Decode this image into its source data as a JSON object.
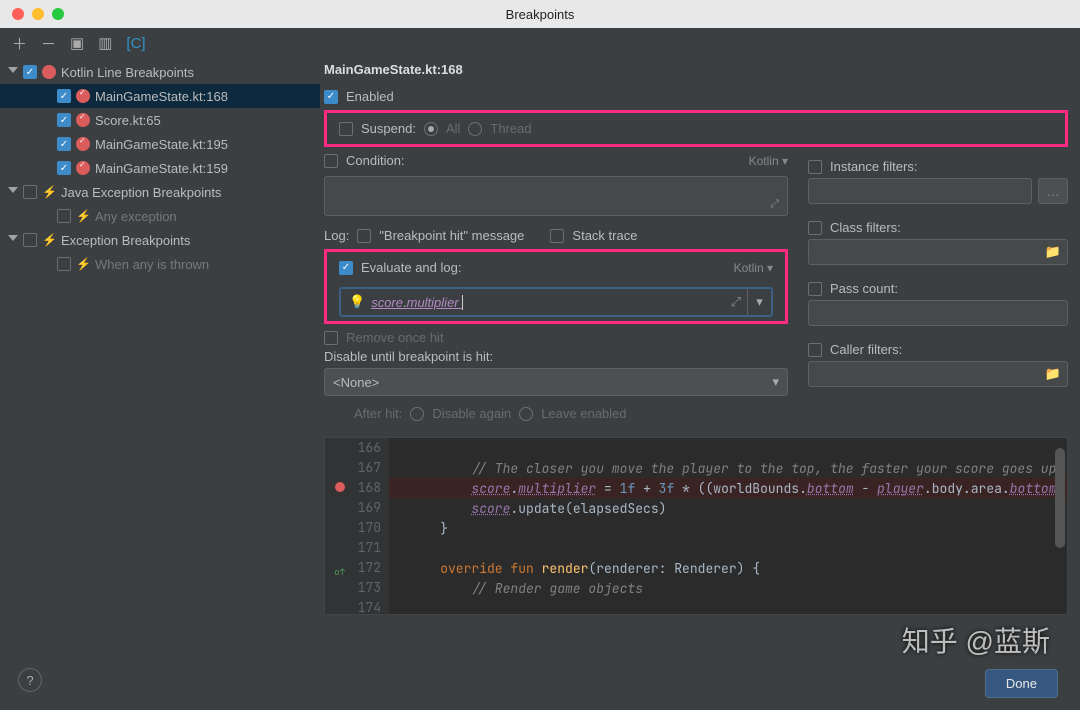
{
  "window": {
    "title": "Breakpoints"
  },
  "tree": {
    "groups": [
      {
        "label": "Kotlin Line Breakpoints",
        "checked": true
      },
      {
        "label": "Java Exception Breakpoints",
        "checked": false
      },
      {
        "label": "Exception Breakpoints",
        "checked": false
      }
    ],
    "kotlin_items": [
      {
        "label": "MainGameState.kt:168",
        "checked": true,
        "selected": true
      },
      {
        "label": "Score.kt:65",
        "checked": true,
        "selected": false
      },
      {
        "label": "MainGameState.kt:195",
        "checked": true,
        "selected": false
      },
      {
        "label": "MainGameState.kt:159",
        "checked": true,
        "selected": false
      }
    ],
    "java_items": [
      {
        "label": "Any exception",
        "checked": false
      }
    ],
    "exc_items": [
      {
        "label": "When any is thrown",
        "checked": false
      }
    ]
  },
  "panel": {
    "title": "MainGameState.kt:168",
    "enabled_label": "Enabled",
    "suspend_label": "Suspend:",
    "suspend_all": "All",
    "suspend_thread": "Thread",
    "condition_label": "Condition:",
    "condition_lang": "Kotlin",
    "log_label": "Log:",
    "log_bp_hit": "\"Breakpoint hit\" message",
    "log_stack": "Stack trace",
    "eval_label": "Evaluate and log:",
    "eval_lang": "Kotlin",
    "eval_expr1": "score",
    "eval_expr2": "multiplier",
    "remove_label": "Remove once hit",
    "disable_until_label": "Disable until breakpoint is hit:",
    "disable_until_value": "<None>",
    "after_hit_label": "After hit:",
    "after_hit_again": "Disable again",
    "after_hit_leave": "Leave enabled",
    "instance_filters": "Instance filters:",
    "class_filters": "Class filters:",
    "pass_count": "Pass count:",
    "caller_filters": "Caller filters:"
  },
  "code": {
    "lines": [
      {
        "n": "166",
        "html": ""
      },
      {
        "n": "167",
        "html": "        <span class='cm'>// The closer you move the player to the top, the faster your score goes up</span>"
      },
      {
        "n": "168",
        "bp": true,
        "hl": true,
        "html": "        <span class='prop'>score</span>.<span class='prop'>multiplier</span> = <span class='nm'>1f</span> + <span class='nm'>3f</span> * ((worldBounds.<span class='prop'>bottom</span> - <span class='prop'>player</span>.body.area.<span class='prop'>bottom</span>)"
      },
      {
        "n": "169",
        "html": "        <span class='prop'>score</span>.update(elapsedSecs)"
      },
      {
        "n": "170",
        "html": "    }"
      },
      {
        "n": "171",
        "html": ""
      },
      {
        "n": "172",
        "ov": true,
        "html": "    <span class='kw'>override fun</span> <span class='fn'>render</span>(renderer: Renderer) {"
      },
      {
        "n": "173",
        "html": "        <span class='cm'>// Render game objects</span>"
      },
      {
        "n": "174",
        "html": "        "
      }
    ]
  },
  "footer": {
    "done": "Done"
  },
  "watermark": "知乎 @蓝斯"
}
